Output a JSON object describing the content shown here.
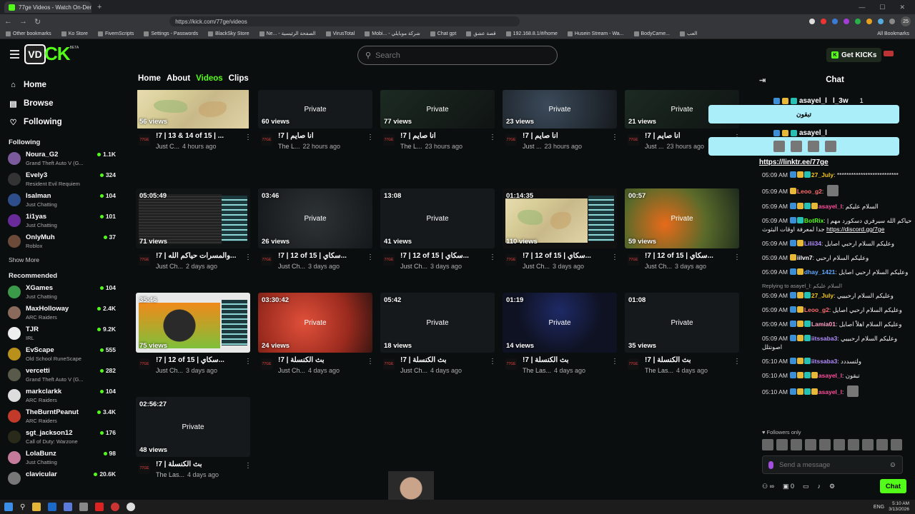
{
  "browser": {
    "tab_title": "77ge Videos - Watch On-Demand",
    "url": "https://kick.com/77ge/videos",
    "profile_badge": "25",
    "bookmarks": [
      "Other bookmarks",
      "Ko Store",
      "FivemScripts",
      "Settings - Passwords",
      "BlackSky Store",
      "Ne... - الصفحة الرئيسية",
      "VirusTotal",
      "Mobi... - شركة موبايلي",
      "Chat gpt",
      "قصة عشق",
      "192.168.8.1/#/home",
      "Husein Stream - Wa...",
      "BodyCame...",
      "العب"
    ],
    "all_bookmarks": "All Bookmarks"
  },
  "header": {
    "logo_box": "VD",
    "logo_text": "CK",
    "logo_badge": "BETA",
    "search_placeholder": "Search",
    "get_kicks": "Get KICKs"
  },
  "sidebar": {
    "nav": [
      {
        "label": "Home",
        "icon": "home-icon"
      },
      {
        "label": "Browse",
        "icon": "browse-icon"
      },
      {
        "label": "Following",
        "icon": "heart-icon"
      }
    ],
    "following_title": "Following",
    "following": [
      {
        "name": "Noura_G2",
        "game": "Grand Theft Auto V (G...",
        "viewers": "1.1K",
        "color": "#7a5a9a"
      },
      {
        "name": "Evely3",
        "game": "Resident Evil Requiem",
        "viewers": "324",
        "color": "#333"
      },
      {
        "name": "lsalman",
        "game": "Just Chatting",
        "viewers": "104",
        "color": "#2d4e8a"
      },
      {
        "name": "1i1yas",
        "game": "Just Chatting",
        "viewers": "101",
        "color": "#6a2b9a"
      },
      {
        "name": "OnlyMuh",
        "game": "Roblox",
        "viewers": "37",
        "color": "#6b4a3a"
      }
    ],
    "show_more": "Show More",
    "recommended_title": "Recommended",
    "recommended": [
      {
        "name": "XGames",
        "game": "Just Chatting",
        "viewers": "104",
        "color": "#3a9a4a"
      },
      {
        "name": "MaxHolloway",
        "game": "ARC Raiders",
        "viewers": "2.4K",
        "color": "#8a6a5a"
      },
      {
        "name": "TJR",
        "game": "IRL",
        "viewers": "9.2K",
        "color": "#eee"
      },
      {
        "name": "EvScape",
        "game": "Old School RuneScape",
        "viewers": "555",
        "color": "#b8901a"
      },
      {
        "name": "vercetti",
        "game": "Grand Theft Auto V (G...",
        "viewers": "282",
        "color": "#5a5a4a"
      },
      {
        "name": "markclarkk",
        "game": "ARC Raiders",
        "viewers": "104",
        "color": "#ddd"
      },
      {
        "name": "TheBurntPeanut",
        "game": "ARC Raiders",
        "viewers": "3.4K",
        "color": "#c43a2a"
      },
      {
        "name": "sgt_jackson12",
        "game": "Call of Duty: Warzone",
        "viewers": "176",
        "color": "#2a2a1a"
      },
      {
        "name": "LolaBunz",
        "game": "Just Chatting",
        "viewers": "98",
        "color": "#c47a9a"
      },
      {
        "name": "clavicular",
        "game": "",
        "viewers": "20.6K",
        "color": "#777"
      }
    ]
  },
  "tabs": [
    "Home",
    "About",
    "Videos",
    "Clips"
  ],
  "active_tab": "Videos",
  "videos": [
    {
      "duration": "",
      "views": "56 views",
      "private": "",
      "title": "!7 | 13 & 14 of 15 | ...",
      "channel": "Just C...",
      "age": "4 hours ago",
      "thumb": "map"
    },
    {
      "duration": "",
      "views": "60 views",
      "private": "Private",
      "title": "!7 | انا صايم",
      "channel": "The L...",
      "age": "22 hours ago",
      "thumb": "dark"
    },
    {
      "duration": "",
      "views": "77 views",
      "private": "Private",
      "title": "!7 | انا صايم",
      "channel": "The L...",
      "age": "23 hours ago",
      "thumb": "darkgreen"
    },
    {
      "duration": "",
      "views": "23 views",
      "private": "Private",
      "title": "!7 | انا صايم",
      "channel": "Just ...",
      "age": "23 hours ago",
      "thumb": "bluegray"
    },
    {
      "duration": "",
      "views": "21 views",
      "private": "Private",
      "title": "!7 | انا صايم",
      "channel": "Just ...",
      "age": "23 hours ago",
      "thumb": "darkgreen"
    },
    {
      "duration": "05:05:49",
      "views": "71 views",
      "private": "",
      "title": "!7 | والمسرات حياكم الله...",
      "channel": "Just Ch...",
      "age": "2 days ago",
      "thumb": "code"
    },
    {
      "duration": "03:46",
      "views": "26 views",
      "private": "Private",
      "title": "!7 | 12 of 15 | سكاي...",
      "channel": "Just Ch...",
      "age": "3 days ago",
      "thumb": "gray"
    },
    {
      "duration": "13:08",
      "views": "41 views",
      "private": "Private",
      "title": "!7 | 12 of 15 | سكاي...",
      "channel": "Just Ch...",
      "age": "3 days ago",
      "thumb": "dark"
    },
    {
      "duration": "01:14:35",
      "views": "110 views",
      "private": "",
      "title": "!7 | 12 of 15 | سكاي...",
      "channel": "Just Ch...",
      "age": "3 days ago",
      "thumb": "mapcode"
    },
    {
      "duration": "00:57",
      "views": "59 views",
      "private": "Private",
      "title": "!7 | 12 of 15 | سكاي...",
      "channel": "Just Ch...",
      "age": "3 days ago",
      "thumb": "orange"
    },
    {
      "duration": "35:46",
      "views": "75 views",
      "private": "",
      "title": "!7 | 12 of 15 | سكاي...",
      "channel": "Just Ch...",
      "age": "3 days ago",
      "thumb": "game"
    },
    {
      "duration": "03:30:42",
      "views": "24 views",
      "private": "Private",
      "title": "!7 | بث الكنسلة",
      "channel": "Just Ch...",
      "age": "4 days ago",
      "thumb": "red"
    },
    {
      "duration": "05:42",
      "views": "18 views",
      "private": "Private",
      "title": "!7 | بث الكنسلة",
      "channel": "Just Ch...",
      "age": "4 days ago",
      "thumb": "dark"
    },
    {
      "duration": "01:19",
      "views": "14 views",
      "private": "Private",
      "title": "!7 | بث الكنسلة",
      "channel": "The Las...",
      "age": "4 days ago",
      "thumb": "blue"
    },
    {
      "duration": "01:08",
      "views": "35 views",
      "private": "Private",
      "title": "!7 | بث الكنسلة",
      "channel": "The Las...",
      "age": "4 days ago",
      "thumb": "dark"
    },
    {
      "duration": "02:56:27",
      "views": "48 views",
      "private": "Private",
      "title": "!7 | بث الكنسلة",
      "channel": "The Las...",
      "age": "4 days ago",
      "thumb": "dark"
    }
  ],
  "chat": {
    "title": "Chat",
    "pinned_link": "https://linktr.ee/77ge",
    "messages": [
      {
        "time": "05:09 AM",
        "user": "27_July",
        "color": "#f5c518",
        "badges": [
          "b1",
          "b2",
          "b3"
        ],
        "text": "**************************"
      },
      {
        "time": "05:09 AM",
        "user": "Leoo_g2",
        "color": "#ff6b6b",
        "badges": [
          "b2"
        ],
        "text": ""
      },
      {
        "time": "05:09 AM",
        "user": "asayel_l",
        "color": "#ff4d9d",
        "badges": [
          "b1",
          "b2",
          "b3",
          "b2"
        ],
        "text": "السلام عليكم"
      },
      {
        "time": "05:09 AM",
        "user": "BotRix",
        "color": "#53fc18",
        "badges": [
          "b1",
          "b3"
        ],
        "text": "حياكم الله سيرفري دسكورد مهم | جدا لمعرفة اوقات البثوث",
        "link": "https://discord.gg/7ge"
      },
      {
        "time": "05:09 AM",
        "user": "Lilii34",
        "color": "#b38cff",
        "badges": [
          "b1",
          "b2"
        ],
        "text": "وعليكم السلام ارحبي اصايل"
      },
      {
        "time": "05:09 AM",
        "user": "iilvn7",
        "color": "#ffffff",
        "badges": [
          "b2"
        ],
        "text": "وعليكم السلام ارحبي"
      },
      {
        "time": "05:09 AM",
        "user": "dhay_1421",
        "color": "#5fa8ff",
        "badges": [
          "b1",
          "b2"
        ],
        "text": "وعليكم السلام ارحبي اصايل"
      },
      {
        "time": "05:09 AM",
        "user": "27_July",
        "color": "#f5c518",
        "badges": [
          "b1",
          "b2",
          "b3"
        ],
        "text": "وعليكم السلام ارحبييي",
        "reply": "Replying to asayel_l: السلام عليكم"
      },
      {
        "time": "05:09 AM",
        "user": "Leoo_g2",
        "color": "#ff6b6b",
        "badges": [
          "b1",
          "b2"
        ],
        "text": "وعليكم السلام ارحبي اصايل"
      },
      {
        "time": "05:09 AM",
        "user": "Lamia01",
        "color": "#ff9fc4",
        "badges": [
          "b1",
          "b2",
          "b3"
        ],
        "text": "وعليكم السلام اهلاً اصايل"
      },
      {
        "time": "05:09 AM",
        "user": "iitssaba3",
        "color": "#b38cff",
        "badges": [
          "b1",
          "b2",
          "b3"
        ],
        "text": "وعليكم السلام ارحبييي اصونتلل"
      },
      {
        "time": "05:10 AM",
        "user": "iitssaba3",
        "color": "#b38cff",
        "badges": [
          "b1",
          "b2",
          "b3"
        ],
        "text": "ولتسددد"
      },
      {
        "time": "05:10 AM",
        "user": "asayel_l",
        "color": "#ff4d9d",
        "badges": [
          "b1",
          "b2",
          "b3",
          "b2"
        ],
        "text": "تبقون"
      },
      {
        "time": "05:10 AM",
        "user": "asayel_l",
        "color": "#ff4d9d",
        "badges": [
          "b1",
          "b2",
          "b3",
          "b2"
        ],
        "text": ""
      }
    ],
    "followers_only": "Followers only",
    "send_placeholder": "Send a message",
    "kick_count": "0",
    "chat_button": "Chat"
  },
  "overlay": {
    "name1": "asayel_l",
    "name1_extra": "l_3w",
    "name1_count": "1",
    "msg1": "تبقون",
    "name2": "asayel_l"
  },
  "taskbar": {
    "lang": "ENG",
    "time": "5:10 AM",
    "date": "3/13/2026"
  }
}
